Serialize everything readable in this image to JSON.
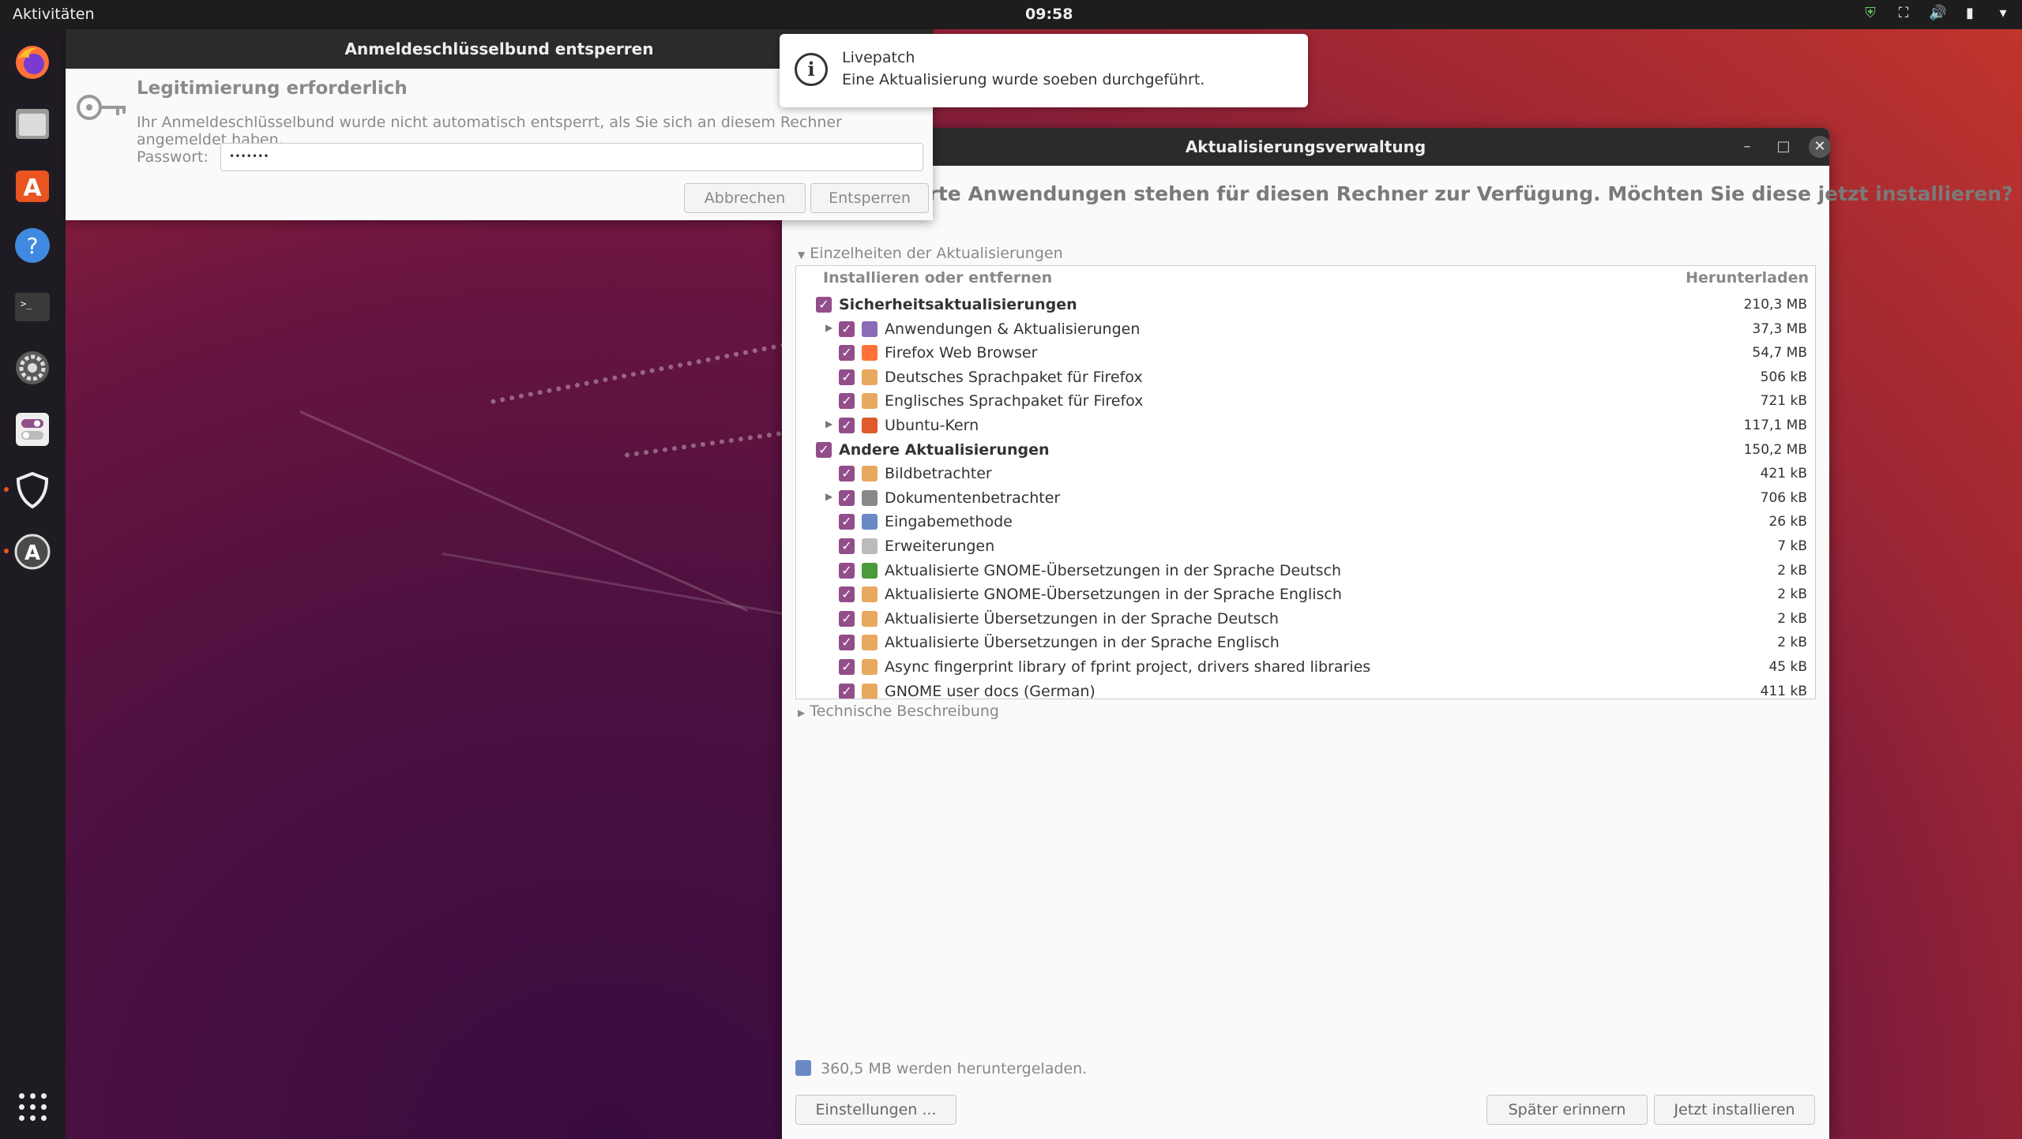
{
  "topbar": {
    "activities": "Aktivitäten",
    "clock": "09:58",
    "tray_icons": [
      "shield-icon",
      "network-icon",
      "volume-icon",
      "battery-icon",
      "chevron-down-icon"
    ]
  },
  "dock": {
    "items": [
      "firefox-icon",
      "files-icon",
      "software-center-icon",
      "help-icon",
      "terminal-icon",
      "settings-icon",
      "toggle-app-icon",
      "shield-app-icon",
      "software-updater-icon"
    ],
    "show_apps": "apps-grid-icon"
  },
  "keyring": {
    "title": "Anmeldeschlüsselbund entsperren",
    "heading": "Legitimierung erforderlich",
    "message": "Ihr Anmeldeschlüsselbund wurde nicht automatisch entsperrt, als Sie sich an diesem Rechner angemeldet haben.",
    "password_label": "Passwort:",
    "password_value": "•••••••",
    "cancel": "Abbrechen",
    "unlock": "Entsperren"
  },
  "notification": {
    "title": "Livepatch",
    "body": "Eine Aktualisierung wurde soeben durchgeführt."
  },
  "updater": {
    "title": "Aktualisierungsverwaltung",
    "heading": "ierte Anwendungen stehen für diesen Rechner zur Verfügung. Möchten Sie diese jetzt installieren?",
    "details_expander": "Einzelheiten der Aktualisierungen",
    "col_install": "Installieren oder entfernen",
    "col_download": "Herunterladen",
    "rows": [
      {
        "label": "Sicherheitsaktualisierungen",
        "size": "210,3 MB",
        "group": true
      },
      {
        "label": "Anwendungen & Aktualisierungen",
        "size": "37,3 MB",
        "expandable": true
      },
      {
        "label": "Firefox Web Browser",
        "size": "54,7 MB"
      },
      {
        "label": "Deutsches Sprachpaket für Firefox",
        "size": "506 kB"
      },
      {
        "label": "Englisches Sprachpaket für Firefox",
        "size": "721 kB"
      },
      {
        "label": "Ubuntu-Kern",
        "size": "117,1 MB",
        "expandable": true
      },
      {
        "label": "Andere Aktualisierungen",
        "size": "150,2 MB",
        "group": true
      },
      {
        "label": "Bildbetrachter",
        "size": "421 kB"
      },
      {
        "label": "Dokumentenbetrachter",
        "size": "706 kB",
        "expandable": true
      },
      {
        "label": "Eingabemethode",
        "size": "26 kB"
      },
      {
        "label": "Erweiterungen",
        "size": "7 kB"
      },
      {
        "label": "Aktualisierte GNOME-Übersetzungen in der Sprache Deutsch",
        "size": "2 kB"
      },
      {
        "label": "Aktualisierte GNOME-Übersetzungen in der Sprache Englisch",
        "size": "2 kB"
      },
      {
        "label": "Aktualisierte Übersetzungen in der Sprache Deutsch",
        "size": "2 kB"
      },
      {
        "label": "Aktualisierte Übersetzungen in der Sprache Englisch",
        "size": "2 kB"
      },
      {
        "label": "Async fingerprint library of fprint project, drivers shared libraries",
        "size": "45 kB"
      },
      {
        "label": "GNOME user docs (German)",
        "size": "411 kB"
      }
    ],
    "tech_expander": "Technische Beschreibung",
    "download_info": "360,5 MB werden heruntergeladen.",
    "settings": "Einstellungen ...",
    "remind_later": "Später erinnern",
    "install_now": "Jetzt installieren"
  },
  "colors": {
    "accent": "#924d8b",
    "topbar": "#1d1d1d",
    "ubuntu_orange": "#e95420"
  }
}
